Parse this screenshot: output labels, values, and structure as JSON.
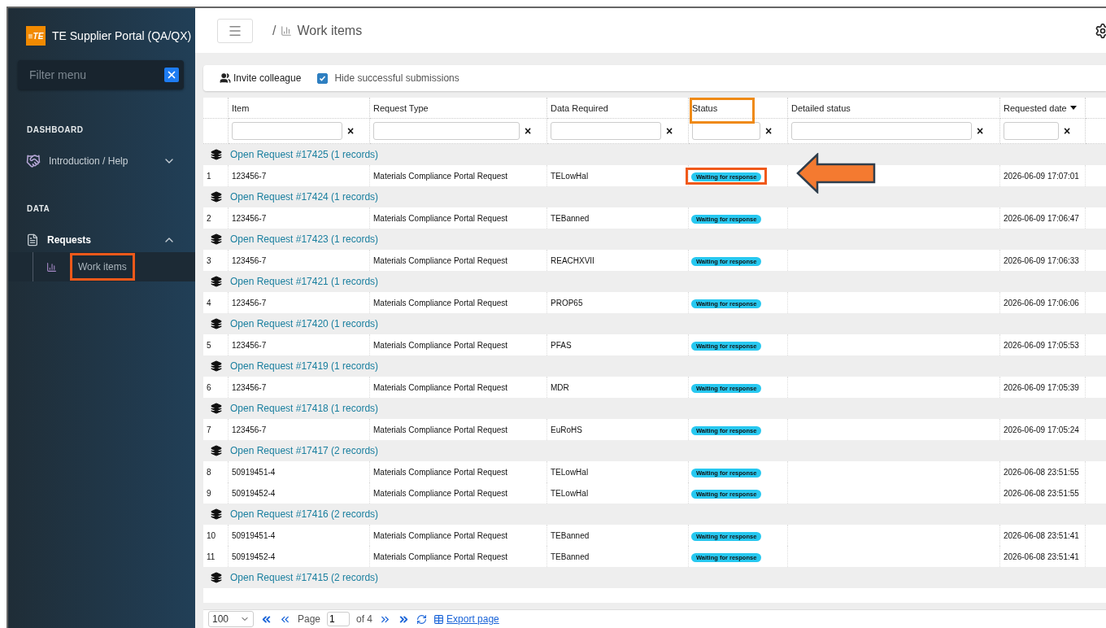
{
  "sidebar": {
    "app_title": "TE Supplier Portal (QA/QX)",
    "logo_text": "≡TE",
    "filter": {
      "placeholder": "Filter menu"
    },
    "sections": [
      {
        "heading": "DASHBOARD",
        "items": [
          {
            "label": "Introduction / Help",
            "expanded": false
          }
        ]
      },
      {
        "heading": "DATA",
        "items": [
          {
            "label": "Requests",
            "expanded": true,
            "children": [
              {
                "label": "Work items",
                "selected": true,
                "highlighted": true
              }
            ]
          }
        ]
      }
    ]
  },
  "topbar": {
    "separator": "/",
    "page_title": "Work items"
  },
  "toolbar": {
    "invite_label": "Invite colleague",
    "hide_successful": {
      "label": "Hide successful submissions",
      "checked": true
    }
  },
  "table": {
    "columns": [
      {
        "filter": false,
        "sorted": false,
        "highlighted": false
      },
      {
        "label": "Item",
        "filter": true,
        "sorted": false,
        "highlighted": false
      },
      {
        "label": "Request Type",
        "filter": true,
        "sorted": false,
        "highlighted": false
      },
      {
        "label": "Data Required",
        "filter": true,
        "sorted": false,
        "highlighted": false
      },
      {
        "label": "Status",
        "filter": true,
        "sorted": false,
        "highlighted": true
      },
      {
        "label": "Detailed status",
        "filter": true,
        "sorted": false,
        "highlighted": false
      },
      {
        "label": "Requested date",
        "filter": true,
        "sorted": true,
        "highlighted": false
      },
      {
        "filter": false,
        "sorted": false,
        "highlighted": false
      }
    ],
    "clear_mark": "×",
    "groups": [
      {
        "title": "Open Request #17425 (1 records)",
        "rows": [
          {
            "index": "1",
            "item": "123456-7",
            "request_type": "Materials Compliance Portal Request",
            "data_required": "TELowHal",
            "status": "Waiting for response",
            "highlighted": true,
            "arrow": true,
            "requested_date": "2026-06-09 17:07:01"
          }
        ]
      },
      {
        "title": "Open Request #17424 (1 records)",
        "rows": [
          {
            "index": "2",
            "item": "123456-7",
            "request_type": "Materials Compliance Portal Request",
            "data_required": "TEBanned",
            "status": "Waiting for response",
            "highlighted": false,
            "arrow": false,
            "requested_date": "2026-06-09 17:06:47"
          }
        ]
      },
      {
        "title": "Open Request #17423 (1 records)",
        "rows": [
          {
            "index": "3",
            "item": "123456-7",
            "request_type": "Materials Compliance Portal Request",
            "data_required": "REACHXVII",
            "status": "Waiting for response",
            "highlighted": false,
            "arrow": false,
            "requested_date": "2026-06-09 17:06:33"
          }
        ]
      },
      {
        "title": "Open Request #17421 (1 records)",
        "rows": [
          {
            "index": "4",
            "item": "123456-7",
            "request_type": "Materials Compliance Portal Request",
            "data_required": "PROP65",
            "status": "Waiting for response",
            "highlighted": false,
            "arrow": false,
            "requested_date": "2026-06-09 17:06:06"
          }
        ]
      },
      {
        "title": "Open Request #17420 (1 records)",
        "rows": [
          {
            "index": "5",
            "item": "123456-7",
            "request_type": "Materials Compliance Portal Request",
            "data_required": "PFAS",
            "status": "Waiting for response",
            "highlighted": false,
            "arrow": false,
            "requested_date": "2026-06-09 17:05:53"
          }
        ]
      },
      {
        "title": "Open Request #17419 (1 records)",
        "rows": [
          {
            "index": "6",
            "item": "123456-7",
            "request_type": "Materials Compliance Portal Request",
            "data_required": "MDR",
            "status": "Waiting for response",
            "highlighted": false,
            "arrow": false,
            "requested_date": "2026-06-09 17:05:39"
          }
        ]
      },
      {
        "title": "Open Request #17418 (1 records)",
        "rows": [
          {
            "index": "7",
            "item": "123456-7",
            "request_type": "Materials Compliance Portal Request",
            "data_required": "EuRoHS",
            "status": "Waiting for response",
            "highlighted": false,
            "arrow": false,
            "requested_date": "2026-06-09 17:05:24"
          }
        ]
      },
      {
        "title": "Open Request #17417 (2 records)",
        "rows": [
          {
            "index": "8",
            "item": "50919451-4",
            "request_type": "Materials Compliance Portal Request",
            "data_required": "TELowHal",
            "status": "Waiting for response",
            "highlighted": false,
            "arrow": false,
            "requested_date": "2026-06-08 23:51:55"
          },
          {
            "index": "9",
            "item": "50919452-4",
            "request_type": "Materials Compliance Portal Request",
            "data_required": "TELowHal",
            "status": "Waiting for response",
            "highlighted": false,
            "arrow": false,
            "requested_date": "2026-06-08 23:51:55"
          }
        ]
      },
      {
        "title": "Open Request #17416 (2 records)",
        "rows": [
          {
            "index": "10",
            "item": "50919451-4",
            "request_type": "Materials Compliance Portal Request",
            "data_required": "TEBanned",
            "status": "Waiting for response",
            "highlighted": false,
            "arrow": false,
            "requested_date": "2026-06-08 23:51:41"
          },
          {
            "index": "11",
            "item": "50919452-4",
            "request_type": "Materials Compliance Portal Request",
            "data_required": "TEBanned",
            "status": "Waiting for response",
            "highlighted": false,
            "arrow": false,
            "requested_date": "2026-06-08 23:51:41"
          }
        ]
      },
      {
        "title": "Open Request #17415 (2 records)"
      }
    ]
  },
  "pager": {
    "page_size": "100",
    "page_label": "Page",
    "page": "1",
    "of_label": "of 4",
    "export_label": "Export page"
  }
}
